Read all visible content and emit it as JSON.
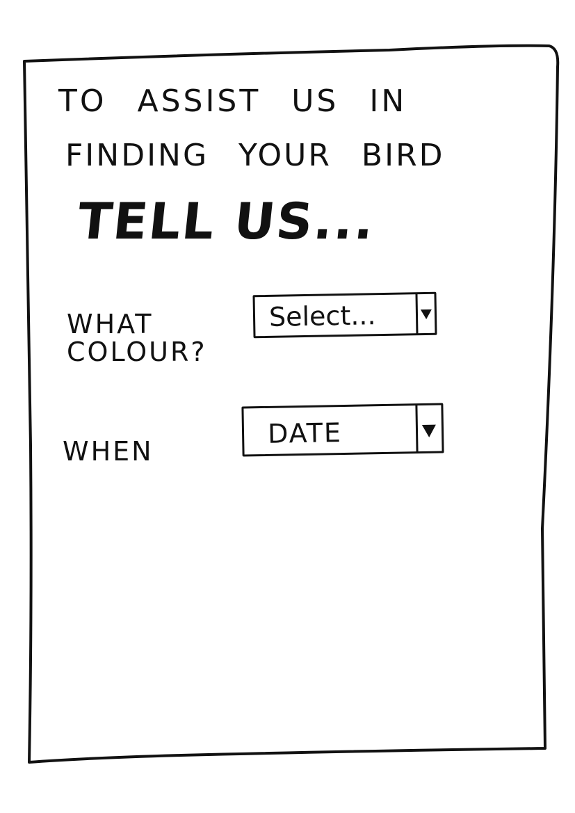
{
  "intro": {
    "line1": "TO ASSIST US IN",
    "line2": "FINDING YOUR BIRD",
    "emphasis": "TELL US..."
  },
  "form": {
    "colour": {
      "label_line1": "WHAT",
      "label_line2": "COLOUR?",
      "selected": "Select...",
      "icon": "chevron-down-icon"
    },
    "when": {
      "label": "WHEN",
      "selected": "DATE",
      "icon": "chevron-down-icon"
    }
  },
  "colors": {
    "ink": "#111111",
    "paper": "#ffffff"
  }
}
